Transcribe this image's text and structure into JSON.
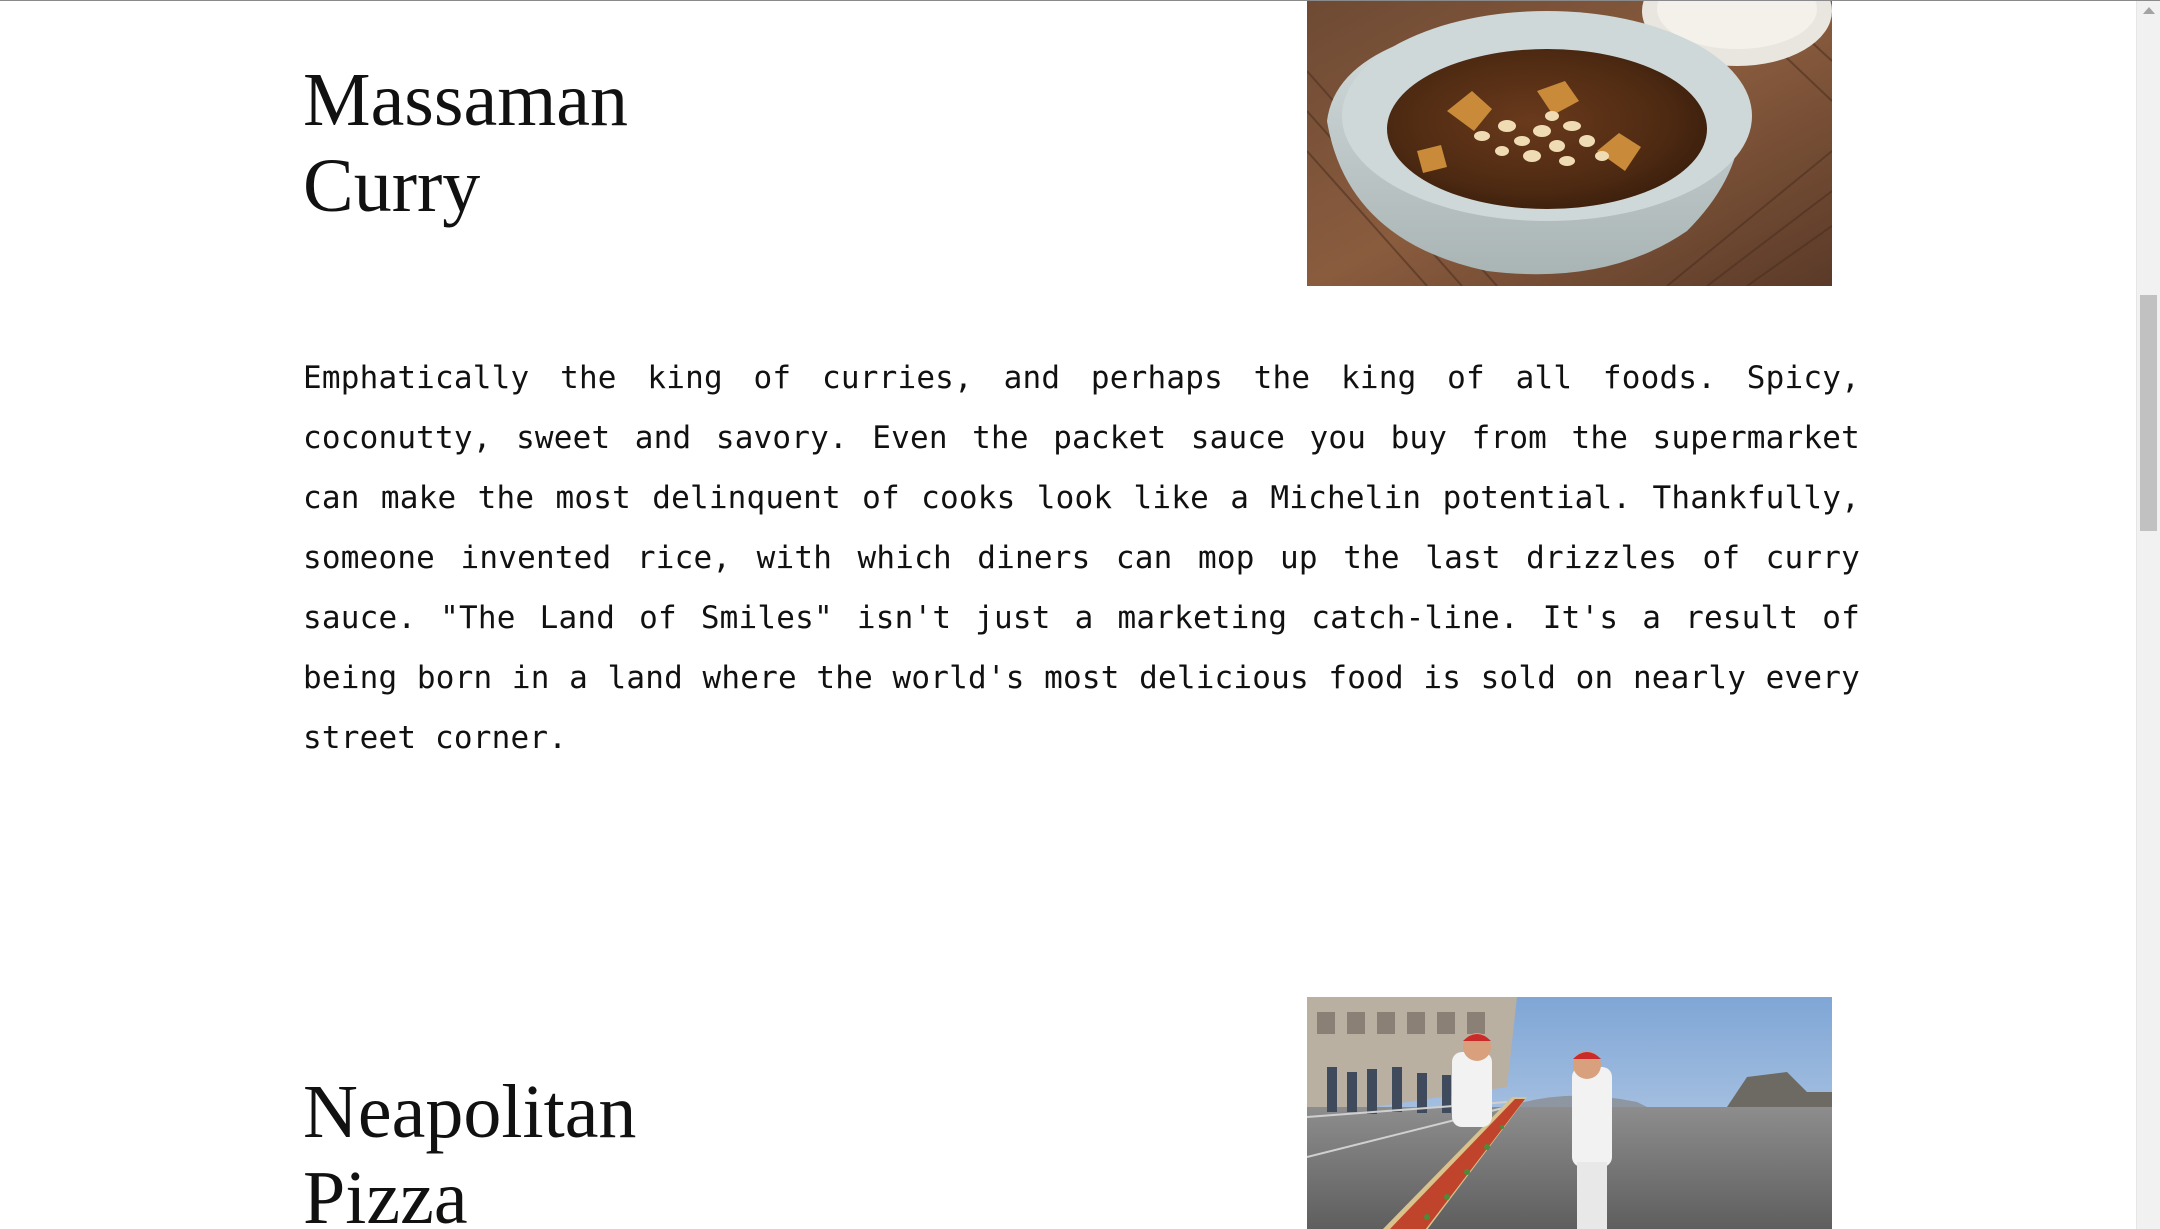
{
  "sections": [
    {
      "title_line1": "Massaman",
      "title_line2": "Curry",
      "image_subject": "bowl of massaman curry with peanuts",
      "description": "Emphatically the king of curries, and perhaps the king of all foods. Spicy, coconutty, sweet and savory. Even the packet sauce you buy from the supermarket can make the most delinquent of cooks look like a Michelin potential. Thankfully, someone invented rice, with which diners can mop up the last drizzles of curry sauce. \"The Land of Smiles\" isn't just a marketing catch-line. It's a result of being born in a land where the world's most delicious food is sold on nearly every street corner."
    },
    {
      "title_line1": "Neapolitan",
      "title_line2": "Pizza",
      "image_subject": "chefs preparing a very long pizza on a seaside street"
    }
  ],
  "colors": {
    "page_background": "#ffffff",
    "text": "#111111",
    "scrollbar_track": "#f1f1f1",
    "scrollbar_thumb": "#c1c1c1"
  }
}
